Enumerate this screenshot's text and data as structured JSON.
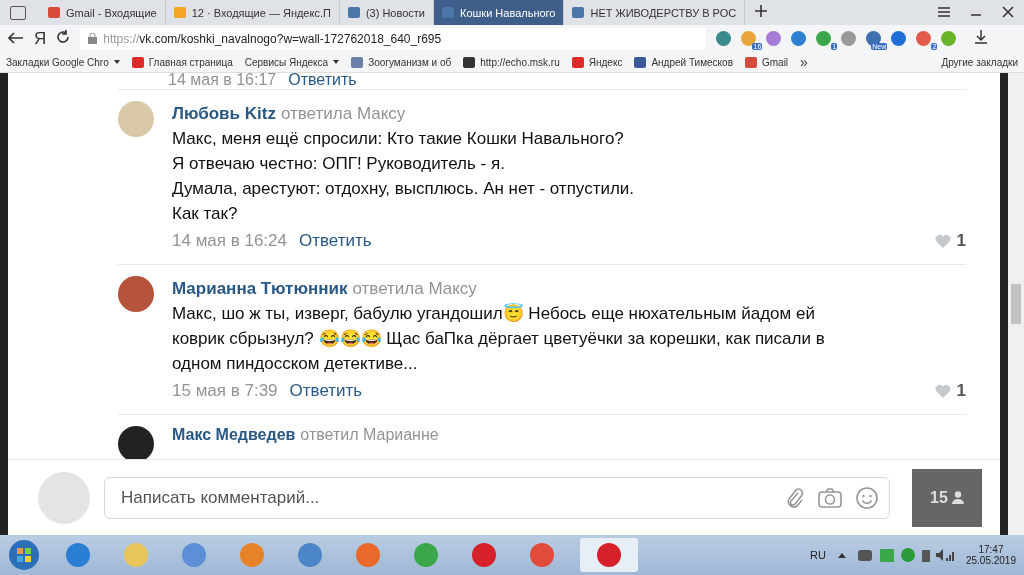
{
  "tabs": [
    {
      "title": "Gmail - Входящие",
      "kind": "gmail",
      "selected": false
    },
    {
      "title": "12 · Входящие — Яндекс.П",
      "kind": "yamail",
      "selected": false
    },
    {
      "title": "(3) Новости",
      "kind": "vk",
      "selected": false
    },
    {
      "title": "Кошки Навального",
      "kind": "vk",
      "selected": true
    },
    {
      "title": "НЕТ ЖИВОДЕРСТВУ В РОС",
      "kind": "vk",
      "selected": false
    }
  ],
  "address": {
    "logo": "Я",
    "url_scheme": "https://",
    "url_rest": "vk.com/koshki_navalnogo?w=wall-172762018_640_r695"
  },
  "extensions": [
    {
      "color": "#3b8a8c"
    },
    {
      "color": "#e8a53a",
      "badge": "16"
    },
    {
      "color": "#a67bd6"
    },
    {
      "color": "#2f7fd1"
    },
    {
      "color": "#3aa84a",
      "badge": "1"
    },
    {
      "color": "#9a9a9a"
    },
    {
      "color": "#3f6fb0",
      "badge": "New"
    },
    {
      "color": "#1f6fd6"
    },
    {
      "color": "#e25b4a",
      "badge": "2"
    },
    {
      "color": "#6bb42a"
    }
  ],
  "bookmarks": [
    {
      "title": "Закладки Google Chro",
      "kind": "folder",
      "dropdown": true
    },
    {
      "title": "Главная страница",
      "kind": "ya",
      "dropdown": false
    },
    {
      "title": "Сервисы Яндекса",
      "kind": "folder",
      "dropdown": true
    },
    {
      "title": "Зоогуманизм и об",
      "kind": "person",
      "dropdown": false
    },
    {
      "title": "http://echo.msk.ru",
      "kind": "echo",
      "dropdown": false
    },
    {
      "title": "Яндекс",
      "kind": "ya",
      "dropdown": false
    },
    {
      "title": "Андрей Тимесков",
      "kind": "fb",
      "dropdown": false
    },
    {
      "title": "Gmail",
      "kind": "gmail",
      "dropdown": false
    }
  ],
  "bookmarks_more": "»",
  "other_bookmarks": "Другие закладки",
  "top_stub": {
    "date": "14 мая в 16:17",
    "reply": "Ответить"
  },
  "comments": [
    {
      "author": "Любовь Kitz",
      "action": "ответила Максу",
      "lines": [
        "Макс, меня ещё спросили: Кто такие Кошки Навального?",
        "Я отвечаю честно: ОПГ! Руководитель - я.",
        "Думала, арестуют: отдохну, высплюсь. Ан нет - отпустили.",
        "Как так?"
      ],
      "date": "14 мая в 16:24",
      "reply": "Ответить",
      "likes": "1"
    },
    {
      "author": "Марианна Тютюнник",
      "action": "ответила Максу",
      "lines": [
        "Макс, шо ж ты, изверг, бабулю угандошил😇 Небось еще нюхательным йадом ей",
        "коврик сбрызнул? 😂😂😂 Щас баПка дёргает цветуёчки за корешки, как писали в",
        "одном пиндосском детективе..."
      ],
      "date": "15 мая в 7:39",
      "reply": "Ответить",
      "likes": "1"
    }
  ],
  "bottom_stub": {
    "author": "Макс Медведев",
    "action": "ответил Марианне"
  },
  "composer": {
    "placeholder": "Написать комментарий...",
    "online": "15"
  },
  "tray": {
    "lang": "RU",
    "time": "17:47",
    "date": "25.05.2019"
  },
  "taskbar": [
    {
      "color": "#2a7fd4",
      "active": false
    },
    {
      "color": "#e8c45a",
      "active": false
    },
    {
      "color": "#5c8fd6",
      "active": false
    },
    {
      "color": "#e8822a",
      "active": false
    },
    {
      "color": "#4a86c8",
      "active": false
    },
    {
      "color": "#e8692a",
      "active": false
    },
    {
      "color": "#3aa84a",
      "active": false
    },
    {
      "color": "#d6202a",
      "active": false
    },
    {
      "color": "#e24a3a",
      "active": false
    },
    {
      "color": "#d6202a",
      "active": true
    }
  ]
}
